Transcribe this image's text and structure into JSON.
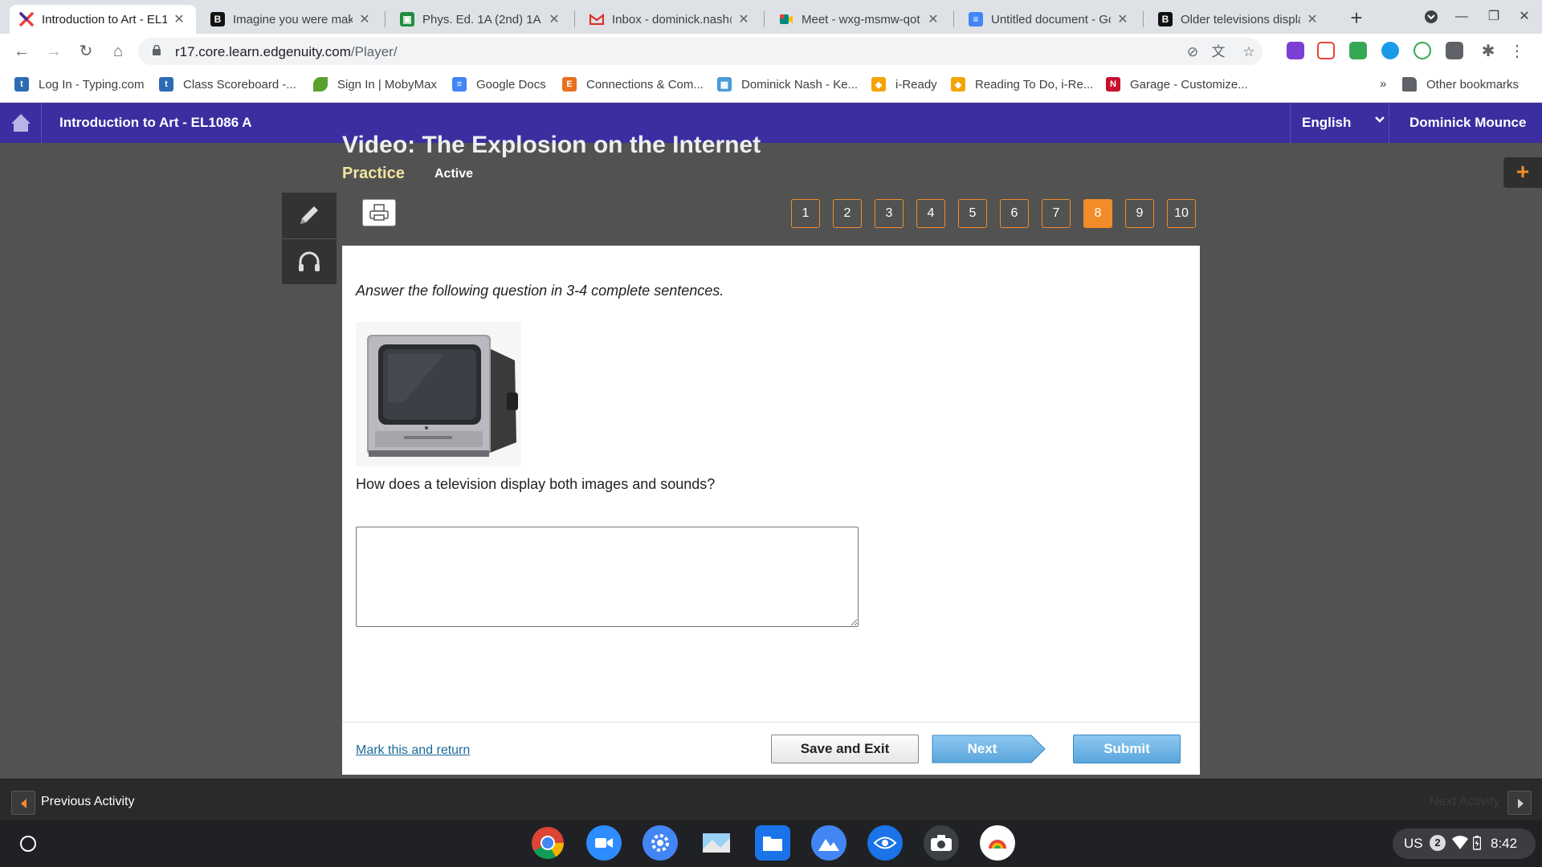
{
  "browser": {
    "tabs": [
      {
        "title": "Introduction to Art - EL1",
        "favicon": "edgenuity-x-icon",
        "color": "#e8453c",
        "active": true
      },
      {
        "title": "Imagine you were maki",
        "favicon": "brainly-b-icon",
        "color": "#111111",
        "active": false
      },
      {
        "title": "Phys. Ed. 1A (2nd) 1A",
        "favicon": "classroom-icon",
        "color": "#1e8e3e",
        "active": false
      },
      {
        "title": "Inbox - dominick.nash@",
        "favicon": "gmail-icon",
        "color": "#d93025",
        "active": false
      },
      {
        "title": "Meet - wxg-msmw-qot",
        "favicon": "meet-icon",
        "color": "#00897b",
        "active": false
      },
      {
        "title": "Untitled document - Go",
        "favicon": "docs-icon",
        "color": "#4285f4",
        "active": false
      },
      {
        "title": "Older televisions displa",
        "favicon": "brainly-b-icon",
        "color": "#111111",
        "active": false
      }
    ],
    "url_host": "r17.core.learn.edgenuity.com",
    "url_path": "/Player/",
    "bookmarks": [
      {
        "label": "Log In - Typing.com",
        "icon": "typing-t-icon",
        "color": "#2d6bb5"
      },
      {
        "label": "Class Scoreboard -...",
        "icon": "typing-t-icon",
        "color": "#2d6bb5"
      },
      {
        "label": "Sign In | MobyMax",
        "icon": "mobymax-leaf-icon",
        "color": "#5aa02c"
      },
      {
        "label": "Google Docs",
        "icon": "docs-icon",
        "color": "#4285f4"
      },
      {
        "label": "Connections & Com...",
        "icon": "edgenuity-e-icon",
        "color": "#e8701e"
      },
      {
        "label": "Dominick Nash - Ke...",
        "icon": "calculator-icon",
        "color": "#4a9bd8"
      },
      {
        "label": "i-Ready",
        "icon": "iready-cube-icon",
        "color": "#f4a300"
      },
      {
        "label": "Reading To Do, i-Re...",
        "icon": "iready-cube-icon",
        "color": "#f4a300"
      },
      {
        "label": "Garage - Customize...",
        "icon": "n-logo-icon",
        "color": "#c8102e"
      }
    ],
    "bookmarks_overflow": "»",
    "other_bookmarks": "Other bookmarks"
  },
  "app": {
    "course_title": "Introduction to Art - EL1086 A",
    "language": "English",
    "user_name": "Dominick Mounce",
    "brand_color": "#3a2ea0",
    "accent_color": "#f28c28"
  },
  "activity": {
    "title": "Video: The Explosion on the Internet",
    "type": "Practice",
    "status": "Active",
    "questions": [
      "1",
      "2",
      "3",
      "4",
      "5",
      "6",
      "7",
      "8",
      "9",
      "10"
    ],
    "current_question": "8"
  },
  "question": {
    "instructions": "Answer the following question in 3-4 complete sentences.",
    "image": "crt-television-image",
    "prompt": "How does a television display both images and sounds?",
    "answer_value": ""
  },
  "footer": {
    "mark_return": "Mark this and return",
    "save_exit": "Save and Exit",
    "next": "Next",
    "submit": "Submit"
  },
  "activity_nav": {
    "previous": "Previous Activity",
    "next": "Next Activity"
  },
  "system": {
    "keyboard": "US",
    "notifications": "2",
    "time": "8:42"
  }
}
